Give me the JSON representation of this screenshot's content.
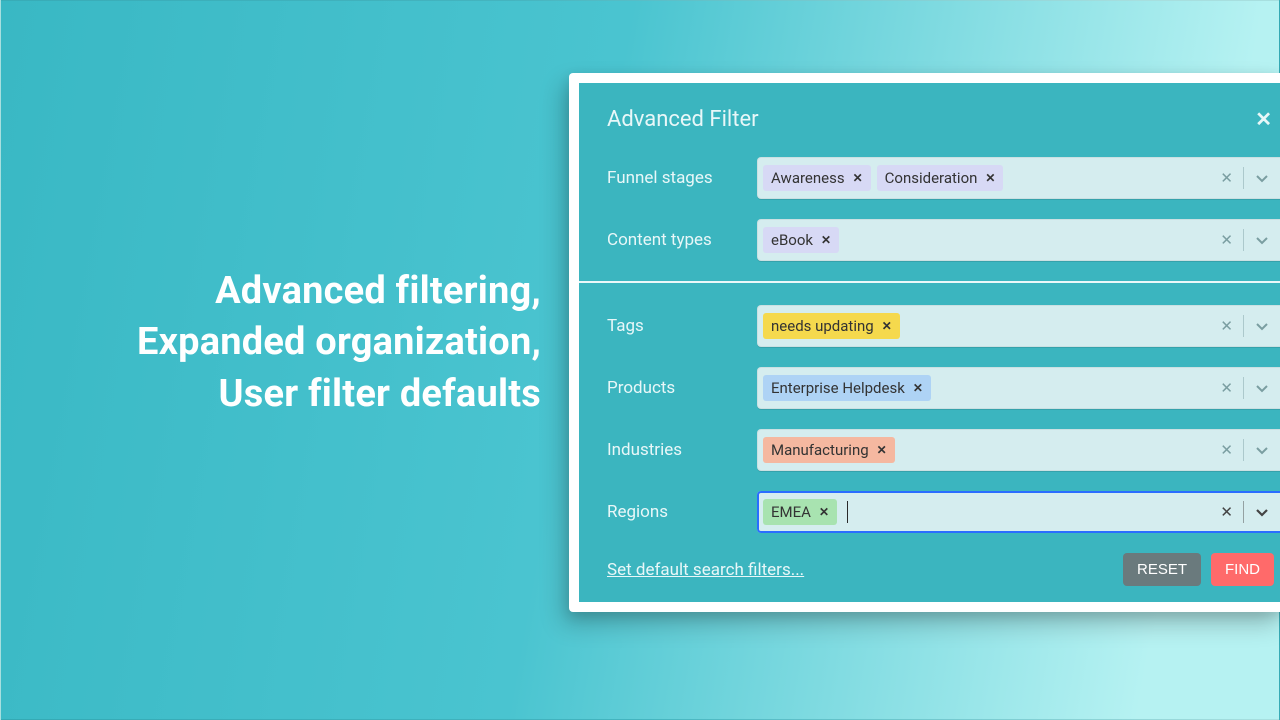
{
  "headline": {
    "line1": "Advanced filtering,",
    "line2": "Expanded organization,",
    "line3": "User filter defaults"
  },
  "panel": {
    "title": "Advanced Filter",
    "rows": {
      "funnel": {
        "label": "Funnel stages",
        "chips": [
          "Awareness",
          "Consideration"
        ],
        "color": "purple",
        "focused": false
      },
      "content": {
        "label": "Content types",
        "chips": [
          "eBook"
        ],
        "color": "purple",
        "focused": false
      },
      "tags": {
        "label": "Tags",
        "chips": [
          "needs updating"
        ],
        "color": "yellow",
        "focused": false
      },
      "products": {
        "label": "Products",
        "chips": [
          "Enterprise Helpdesk"
        ],
        "color": "blue",
        "focused": false
      },
      "industries": {
        "label": "Industries",
        "chips": [
          "Manufacturing"
        ],
        "color": "salmon",
        "focused": false
      },
      "regions": {
        "label": "Regions",
        "chips": [
          "EMEA"
        ],
        "color": "green",
        "focused": true
      }
    },
    "link": "Set default search filters...",
    "buttons": {
      "reset": "RESET",
      "find": "FIND"
    }
  }
}
